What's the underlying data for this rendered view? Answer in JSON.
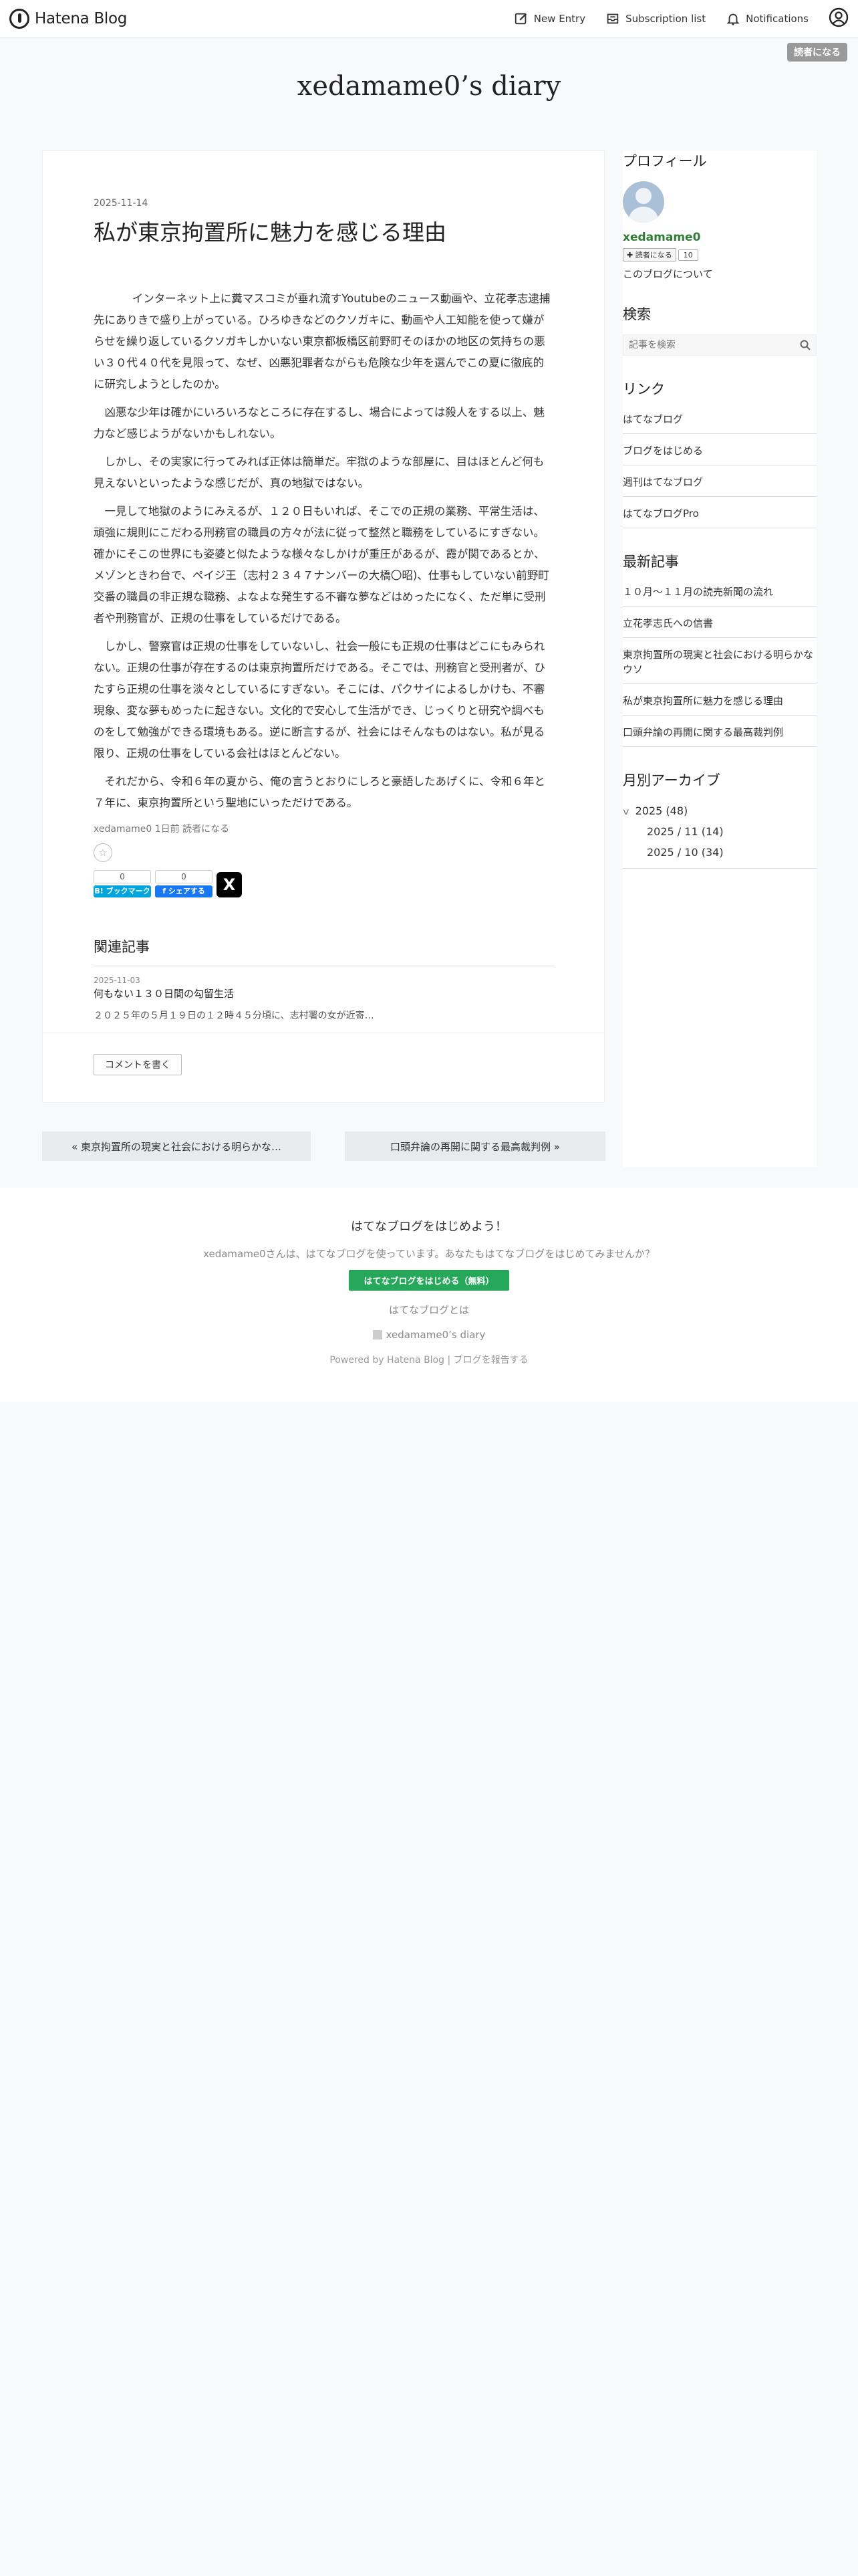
{
  "header": {
    "logo_text": "Hatena Blog",
    "new_entry": "New Entry",
    "subscription": "Subscription list",
    "notifications": "Notifications",
    "reader_button": "読者になる"
  },
  "blog": {
    "title": "xedamame0’s diary"
  },
  "entry": {
    "date": "2025-11-14",
    "title": "私が東京拘置所に魅力を感じる理由",
    "paragraphs": [
      "インターネット上に糞マスコミが垂れ流すYoutubeのニュース動画や、立花孝志逮捕先にありきで盛り上がっている。ひろゆきなどのクソガキに、動画や人工知能を使って嫌がらせを繰り返しているクソガキしかいない東京都板橋区前野町そのほかの地区の気持ちの悪い３０代４０代を見限って、なぜ、凶悪犯罪者ながらも危険な少年を選んでこの夏に徹底的に研究しようとしたのか。",
      "凶悪な少年は確かにいろいろなところに存在するし、場合によっては殺人をする以上、魅力など感じようがないかもしれない。",
      "しかし、その実家に行ってみれば正体は簡単だ。牢獄のような部屋に、目はほとんど何も見えないといったような感じだが、真の地獄ではない。",
      "一見して地獄のようにみえるが、１２０日もいれば、そこでの正規の業務、平常生活は、頑強に規則にこだわる刑務官の職員の方々が法に従って整然と職務をしているにすぎない。確かにそこの世界にも姿婆と似たような様々なしかけが重圧があるが、霞が関であるとか、メゾンときわ台で、ペイジ王（志村２３４７ナンバーの大橋〇昭)、仕事もしていない前野町交番の職員の非正規な職務、よなよな発生する不審な夢などはめったになく、ただ単に受刑者や刑務官が、正規の仕事をしているだけである。",
      "しかし、警察官は正規の仕事をしていないし、社会一般にも正規の仕事はどこにもみられない。正規の仕事が存在するのは東京拘置所だけである。そこでは、刑務官と受刑者が、ひたすら正規の仕事を淡々としているにすぎない。そこには、パクサイによるしかけも、不審現象、変な夢もめったに起きない。文化的で安心して生活ができ、じっくりと研究や調べものをして勉強ができる環境もある。逆に断言するが、社会にはそんなものはない。私が見る限り、正規の仕事をしている会社はほとんどない。",
      "それだから、令和６年の夏から、俺の言うとおりにしろと豪語したあげくに、令和６年と７年に、東京拘置所という聖地にいっただけである。"
    ],
    "footer_author": "xedamame0",
    "footer_time": "1日前",
    "footer_reader": "読者になる",
    "hatebu_count": "0",
    "hatebu_label": "B! ブックマーク",
    "fb_count": "0",
    "fb_label": "f シェアする",
    "x_label": "X"
  },
  "related": {
    "heading": "関連記事",
    "item_date": "2025-11-03",
    "item_title": "何もない１３０日間の勾留生活",
    "item_excerpt": "２０２５年の５月１９日の１２時４５分頃に、志村署の女が近寄…"
  },
  "comment_button": "コメントを書く",
  "pager": {
    "prev": "« 東京拘置所の現実と社会における明らかな…",
    "next": "口頭弁論の再開に関する最高裁判例 »"
  },
  "sidebar": {
    "profile_heading": "プロフィール",
    "profile_name": "xedamame0",
    "follow_label": "✚ 読者になる",
    "follow_count": "10",
    "about": "このブログについて",
    "search_heading": "検索",
    "search_placeholder": "記事を検索",
    "links_heading": "リンク",
    "links": [
      "はてなブログ",
      "ブログをはじめる",
      "週刊はてなブログ",
      "はてなブログPro"
    ],
    "recent_heading": "最新記事",
    "recent": [
      "１０月〜１１月の読売新聞の流れ",
      "立花孝志氏への信書",
      "東京拘置所の現実と社会における明らかなウソ",
      "私が東京拘置所に魅力を感じる理由",
      "口頭弁論の再開に関する最高裁判例"
    ],
    "archive_heading": "月別アーカイブ",
    "archive_year": "2025 (48)",
    "archive_months": [
      "2025 / 11 (14)",
      "2025 / 10 (34)"
    ]
  },
  "footer": {
    "heading": "はてなブログをはじめよう！",
    "text": "xedamame0さんは、はてなブログを使っています。あなたもはてなブログをはじめてみませんか？",
    "button": "はてなブログをはじめる（無料）",
    "about": "はてなブログとは",
    "blog_name": "xedamame0’s diary",
    "powered": "Powered by Hatena Blog | ブログを報告する"
  }
}
